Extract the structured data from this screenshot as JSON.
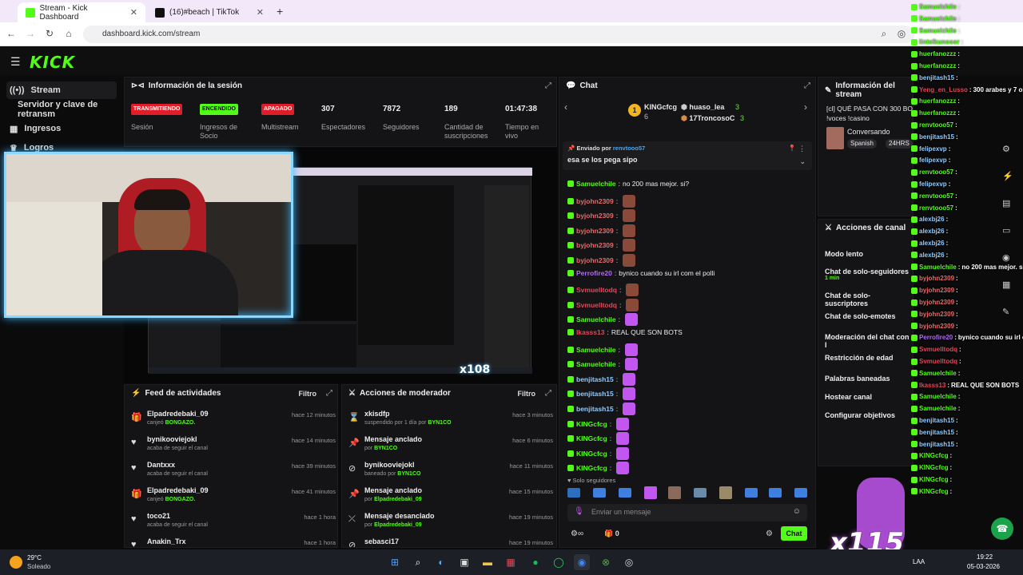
{
  "browser": {
    "tabs": [
      {
        "label": "Stream - Kick Dashboard",
        "active": true
      },
      {
        "label": "(16)#beach | TikTok",
        "active": false
      }
    ],
    "url": "dashboard.kick.com/stream"
  },
  "brand": {
    "logo": "KICK",
    "accent": "#53fc18"
  },
  "sidebar": {
    "items": [
      {
        "label": "Stream",
        "icon": "broadcast-icon",
        "active": true
      },
      {
        "label": "Servidor y clave de retransm",
        "icon": ""
      },
      {
        "label": "Ingresos",
        "icon": "grid-icon"
      },
      {
        "label": "Logros",
        "icon": "trophy-icon"
      }
    ]
  },
  "session": {
    "title": "Información de la sesión",
    "items": [
      {
        "status": "TRANSMITIENDO",
        "label": "Sesión"
      },
      {
        "status": "ENCENDIDO",
        "label": "Ingresos de Socio"
      },
      {
        "status": "APAGADO",
        "label": "Multistream"
      },
      {
        "value": "307",
        "label": "Espectadores"
      },
      {
        "value": "7872",
        "label": "Seguidores"
      },
      {
        "value": "189",
        "label": "Cantidad de suscripciones"
      },
      {
        "value": "01:47:38",
        "label": "Tiempo en vivo"
      }
    ]
  },
  "preview": {
    "overlay_text": "x108"
  },
  "feed": {
    "title": "Feed de actividades",
    "filter": "Filtro",
    "rows": [
      {
        "name": "Elpadredebaki_09",
        "sub_pre": "canjeó",
        "sub_hl": "BONGAZO.",
        "time": "hace 12 minutos",
        "icon": "gift-icon"
      },
      {
        "name": "bynikooviejokl",
        "sub_pre": "acaba de seguir el canal",
        "sub_hl": "",
        "time": "hace 14 minutos",
        "icon": "heart-icon"
      },
      {
        "name": "Dantxxx",
        "sub_pre": "acaba de seguir el canal",
        "sub_hl": "",
        "time": "hace 39 minutos",
        "icon": "heart-icon"
      },
      {
        "name": "Elpadredebaki_09",
        "sub_pre": "canjeó",
        "sub_hl": "BONGAZO.",
        "time": "hace 41 minutos",
        "icon": "gift-icon"
      },
      {
        "name": "toco21",
        "sub_pre": "acaba de seguir el canal",
        "sub_hl": "",
        "time": "hace 1 hora",
        "icon": "heart-icon"
      },
      {
        "name": "Anakin_Trx",
        "sub_pre": "",
        "sub_hl": "",
        "time": "hace 1 hora",
        "icon": "heart-icon"
      }
    ]
  },
  "mod": {
    "title": "Acciones de moderador",
    "filter": "Filtro",
    "rows": [
      {
        "name": "xkisdfp",
        "sub_pre": "suspendido por 1 día por",
        "sub_hl": "BYN1CO",
        "time": "hace 3 minutos",
        "icon": "hourglass-icon"
      },
      {
        "name": "Mensaje anclado",
        "sub_pre": "por",
        "sub_hl": "BYN1CO",
        "time": "hace 6 minutos",
        "icon": "pin-icon"
      },
      {
        "name": "bynikooviejokl",
        "sub_pre": "baneado por",
        "sub_hl": "BYN1CO",
        "time": "hace 11 minutos",
        "icon": "ban-icon"
      },
      {
        "name": "Mensaje anclado",
        "sub_pre": "por",
        "sub_hl": "Elpadredebaki_09",
        "time": "hace 15 minutos",
        "icon": "pin-icon"
      },
      {
        "name": "Mensaje desanclado",
        "sub_pre": "por",
        "sub_hl": "Elpadredebaki_09",
        "time": "hace 19 minutos",
        "icon": "unpin-icon"
      },
      {
        "name": "sebasci17",
        "sub_pre": "",
        "sub_hl": "",
        "time": "hace 19 minutos",
        "icon": "ban-icon"
      }
    ]
  },
  "chat": {
    "title": "Chat",
    "leader1": {
      "name": "KINGcfcg",
      "count": "6"
    },
    "leader2": {
      "name": "huaso_lea",
      "count": "3"
    },
    "leader3": {
      "name": "17TroncosoC",
      "count": "3"
    },
    "pinned": {
      "by_label": "Enviado por",
      "by_user": "renvtooo57",
      "text": "esa se los pega sipo"
    },
    "messages": [
      {
        "user": "Samuelchile",
        "color": "#53fc18",
        "text": "no 200 mas mejor. si?",
        "emote": false
      },
      {
        "user": "byjohn2309",
        "color": "#e26b6b",
        "text": "",
        "emote": true
      },
      {
        "user": "byjohn2309",
        "color": "#e26b6b",
        "text": "",
        "emote": true
      },
      {
        "user": "byjohn2309",
        "color": "#e26b6b",
        "text": "",
        "emote": true
      },
      {
        "user": "byjohn2309",
        "color": "#e26b6b",
        "text": "",
        "emote": true
      },
      {
        "user": "byjohn2309",
        "color": "#e26b6b",
        "text": "",
        "emote": true
      },
      {
        "user": "Perrofire20",
        "color": "#b16cf0",
        "text": "bynico cuando su irl com el polli",
        "emote": false
      },
      {
        "user": "Svmuelltodq",
        "color": "#e0475a",
        "text": "",
        "emote": true
      },
      {
        "user": "Svmuelltodq",
        "color": "#e0475a",
        "text": "",
        "emote": true
      },
      {
        "user": "Samuelchile",
        "color": "#53fc18",
        "text": "",
        "emote": true
      },
      {
        "user": "Ikasss13",
        "color": "#e0475a",
        "text": "REAL QUE SON BOTS",
        "emote": false
      },
      {
        "user": "Samuelchile",
        "color": "#53fc18",
        "text": "",
        "emote": true
      },
      {
        "user": "Samuelchile",
        "color": "#53fc18",
        "text": "",
        "emote": true
      },
      {
        "user": "benjitash15",
        "color": "#8ecbff",
        "text": "",
        "emote": true
      },
      {
        "user": "benjitash15",
        "color": "#8ecbff",
        "text": "",
        "emote": true
      },
      {
        "user": "benjitash15",
        "color": "#8ecbff",
        "text": "",
        "emote": true
      },
      {
        "user": "KINGcfcg",
        "color": "#53fc18",
        "text": "",
        "emote": true
      },
      {
        "user": "KINGcfcg",
        "color": "#53fc18",
        "text": "",
        "emote": true
      },
      {
        "user": "KINGcfcg",
        "color": "#53fc18",
        "text": "",
        "emote": true
      },
      {
        "user": "KINGcfcg",
        "color": "#53fc18",
        "text": "",
        "emote": true
      }
    ],
    "followers_only": "Solo seguidores",
    "input_placeholder": "Enviar un mensaje",
    "send_label": "Chat",
    "footer_count": "0"
  },
  "stream_info": {
    "title": "Información del stream",
    "stream_title": "[cl] QUÉ PASA CON 300 BOTS",
    "commands": "!voces !casino",
    "category": "Conversando",
    "tags": [
      "Spanish",
      "24HRS"
    ]
  },
  "channel_actions": {
    "title": "Acciones de canal",
    "items": [
      {
        "label": "Modo lento",
        "sub": ""
      },
      {
        "label": "Chat de solo-seguidores",
        "sub": "1 min"
      },
      {
        "label": "Chat de solo-suscriptores",
        "sub": ""
      },
      {
        "label": "Chat de solo-emotes",
        "sub": ""
      },
      {
        "label": "Moderación del chat con I",
        "sub": ""
      },
      {
        "label": "Restricción de edad",
        "sub": ""
      },
      {
        "label": "Palabras baneadas",
        "sub": ""
      },
      {
        "label": "Hostear canal",
        "sub": ""
      },
      {
        "label": "Configurar objetivos",
        "sub": ""
      }
    ]
  },
  "overlay": {
    "lines": [
      {
        "user": "Samuelchile",
        "color": "#53fc18",
        "text": ""
      },
      {
        "user": "Samuelchile",
        "color": "#53fc18",
        "text": ""
      },
      {
        "user": "Samuelchile",
        "color": "#53fc18",
        "text": ""
      },
      {
        "user": "lintelkunooor",
        "color": "#53fc18",
        "text": ""
      },
      {
        "user": "huerfanozzz",
        "color": "#53fc18",
        "text": ""
      },
      {
        "user": "huerfanozzz",
        "color": "#53fc18",
        "text": ""
      },
      {
        "user": "benjitash15",
        "color": "#8ecbff",
        "text": ""
      },
      {
        "user": "Yeng_en_Lusso",
        "color": "#e0475a",
        "text": "300 arabes y 7 organicos"
      },
      {
        "user": "huerfanozzz",
        "color": "#53fc18",
        "text": ""
      },
      {
        "user": "huerfanozzz",
        "color": "#53fc18",
        "text": ""
      },
      {
        "user": "renvtooo57",
        "color": "#53fc18",
        "text": ""
      },
      {
        "user": "benjitash15",
        "color": "#8ecbff",
        "text": ""
      },
      {
        "user": "felipexvp",
        "color": "#8ecbff",
        "text": ""
      },
      {
        "user": "felipexvp",
        "color": "#8ecbff",
        "text": ""
      },
      {
        "user": "renvtooo57",
        "color": "#53fc18",
        "text": ""
      },
      {
        "user": "felipexvp",
        "color": "#8ecbff",
        "text": ""
      },
      {
        "user": "renvtooo57",
        "color": "#53fc18",
        "text": ""
      },
      {
        "user": "renvtooo57",
        "color": "#53fc18",
        "text": ""
      },
      {
        "user": "alexbj26",
        "color": "#8ecbff",
        "text": ""
      },
      {
        "user": "alexbj26",
        "color": "#8ecbff",
        "text": ""
      },
      {
        "user": "alexbj26",
        "color": "#8ecbff",
        "text": ""
      },
      {
        "user": "alexbj26",
        "color": "#8ecbff",
        "text": ""
      },
      {
        "user": "Samuelchile",
        "color": "#53fc18",
        "text": "no 200 mas mejor. si?"
      },
      {
        "user": "byjohn2309",
        "color": "#e26b6b",
        "text": ""
      },
      {
        "user": "byjohn2309",
        "color": "#e26b6b",
        "text": ""
      },
      {
        "user": "byjohn2309",
        "color": "#e26b6b",
        "text": ""
      },
      {
        "user": "byjohn2309",
        "color": "#e26b6b",
        "text": ""
      },
      {
        "user": "byjohn2309",
        "color": "#e26b6b",
        "text": ""
      },
      {
        "user": "Perrofire20",
        "color": "#b16cf0",
        "text": "bynico cuando su irl com el polli"
      },
      {
        "user": "Svmuelltodq",
        "color": "#e0475a",
        "text": ""
      },
      {
        "user": "Svmuelltodq",
        "color": "#e0475a",
        "text": ""
      },
      {
        "user": "Samuelchile",
        "color": "#53fc18",
        "text": ""
      },
      {
        "user": "Ikasss13",
        "color": "#e0475a",
        "text": "REAL QUE SON BOTS"
      },
      {
        "user": "Samuelchile",
        "color": "#53fc18",
        "text": ""
      },
      {
        "user": "Samuelchile",
        "color": "#53fc18",
        "text": ""
      },
      {
        "user": "benjitash15",
        "color": "#8ecbff",
        "text": ""
      },
      {
        "user": "benjitash15",
        "color": "#8ecbff",
        "text": ""
      },
      {
        "user": "benjitash15",
        "color": "#8ecbff",
        "text": ""
      },
      {
        "user": "KINGcfcg",
        "color": "#53fc18",
        "text": ""
      },
      {
        "user": "KINGcfcg",
        "color": "#53fc18",
        "text": ""
      },
      {
        "user": "KINGcfcg",
        "color": "#53fc18",
        "text": ""
      },
      {
        "user": "KINGcfcg",
        "color": "#53fc18",
        "text": ""
      }
    ],
    "multiplier": "x115"
  },
  "taskbar": {
    "weather_temp": "29°C",
    "weather_desc": "Soleado",
    "lang": "LAA",
    "time": "19:22",
    "date": "05-03-2026"
  }
}
